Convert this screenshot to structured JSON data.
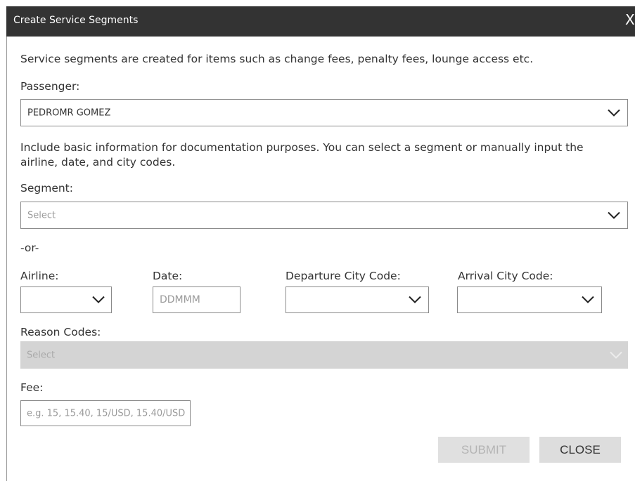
{
  "dialog": {
    "title": "Create Service Segments",
    "close_glyph": "X",
    "intro": "Service segments are created for items such as change fees, penalty fees, lounge access etc."
  },
  "passenger": {
    "label": "Passenger:",
    "value": "PEDROMR GOMEZ"
  },
  "description": "Include basic information for documentation purposes. You can select a segment or manually input the airline, date, and city codes.",
  "segment": {
    "label": "Segment:",
    "placeholder": "Select"
  },
  "or_text": "-or-",
  "airline": {
    "label": "Airline:",
    "value": ""
  },
  "date": {
    "label": "Date:",
    "placeholder": "DDMMM"
  },
  "departure": {
    "label": "Departure City Code:",
    "value": ""
  },
  "arrival": {
    "label": "Arrival City Code:",
    "value": ""
  },
  "reason": {
    "label": "Reason Codes:",
    "placeholder": "Select",
    "disabled": true
  },
  "fee": {
    "label": "Fee:",
    "placeholder": "e.g. 15, 15.40, 15/USD, 15.40/USD"
  },
  "buttons": {
    "submit": "SUBMIT",
    "close": "CLOSE"
  },
  "colors": {
    "titlebar": "#333333",
    "text": "#333333",
    "placeholder": "#9b9b9b",
    "disabled_bg": "#d4d4d4",
    "button_bg": "#dddddd"
  },
  "icons": {
    "dropdown": "chevron-down-icon",
    "close": "close-icon"
  }
}
